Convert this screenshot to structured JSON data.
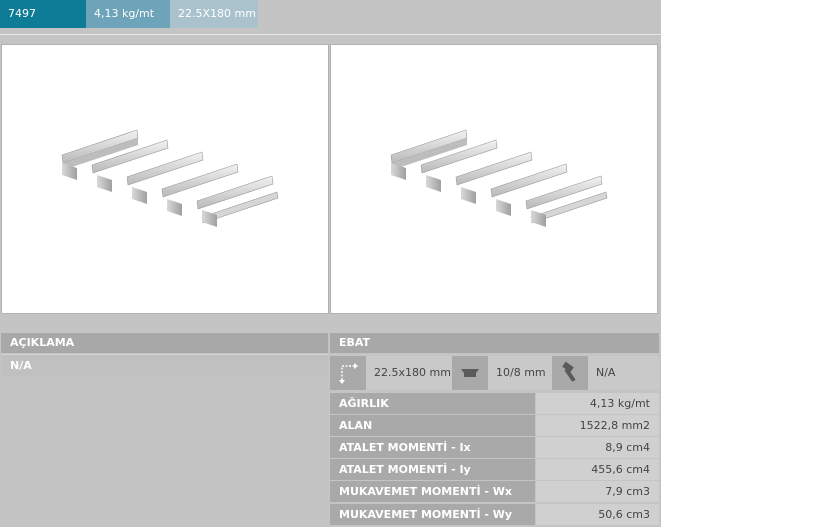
{
  "header": {
    "code": "7497",
    "weight": "4,13 kg/mt",
    "size": "22.5X180 mm"
  },
  "images": [
    {
      "icon": "aluminum-profile-image"
    },
    {
      "icon": "aluminum-profile-image"
    }
  ],
  "description": {
    "title": "AÇIKLAMA",
    "value": "N/A"
  },
  "dimensions": {
    "title": "EBAT",
    "size_icon": "dimension-icon",
    "size": "22.5x180 mm",
    "slot_icon": "slot-nut-icon",
    "slot": "10/8 mm",
    "bolt_icon": "bolt-icon",
    "bolt": "N/A"
  },
  "properties": [
    {
      "label": "AĞIRLIK",
      "value": "4,13 kg/mt"
    },
    {
      "label": "ALAN",
      "value": "1522,8 mm2"
    },
    {
      "label": "ATALET MOMENTİ - Ix",
      "value": "8,9 cm4"
    },
    {
      "label": "ATALET MOMENTİ - Iy",
      "value": "455,6 cm4"
    },
    {
      "label": "MUKAVEMET MOMENTİ - Wx",
      "value": "7,9 cm3"
    },
    {
      "label": "MUKAVEMET MOMENTİ - Wy",
      "value": "50,6 cm3"
    }
  ],
  "colors": {
    "accent": "#0e7b97",
    "accent_light": "#6ea4b9",
    "accent_lighter": "#a9c2cc",
    "panel_bg": "#c4c4c4",
    "header_bg": "#a8a8a8"
  }
}
